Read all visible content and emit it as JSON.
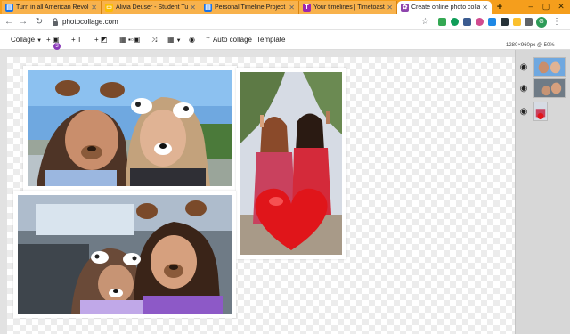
{
  "browser": {
    "tabs": [
      {
        "title": "Turn in all American Revolutio",
        "favicon_color": "#1a73e8",
        "favicon_glyph": "doc-icon"
      },
      {
        "title": "Alivia Deuser - Student Turn in",
        "favicon_color": "#fbbc04",
        "favicon_glyph": "slides-icon"
      },
      {
        "title": "Personal Timeline Project - Go",
        "favicon_color": "#1a73e8",
        "favicon_glyph": "doc-icon"
      },
      {
        "title": "Your timelines | Timetoast tim",
        "favicon_color": "#9c27b0",
        "favicon_glyph": "T"
      },
      {
        "title": "Create online photo collages",
        "favicon_color": "#8e44ad",
        "favicon_glyph": "photocollage-icon"
      }
    ],
    "new_tab_label": "+",
    "url": "photocollage.com"
  },
  "toolbar": {
    "collage_label": "Collage",
    "add_photo_count": "3",
    "text_label": "T",
    "auto_collage_label": "Auto collage",
    "template_label": "Template"
  },
  "canvas": {
    "size_label": "1280×960px @ 50%"
  },
  "layers": [
    {
      "name": "photo-layer-1",
      "visible": true
    },
    {
      "name": "photo-layer-2",
      "visible": true
    },
    {
      "name": "photo-layer-3",
      "visible": true
    }
  ],
  "colors": {
    "tabstrip": "#f59e1c",
    "accent_purple": "#8a3ab9",
    "heart_red": "#e0151a"
  }
}
